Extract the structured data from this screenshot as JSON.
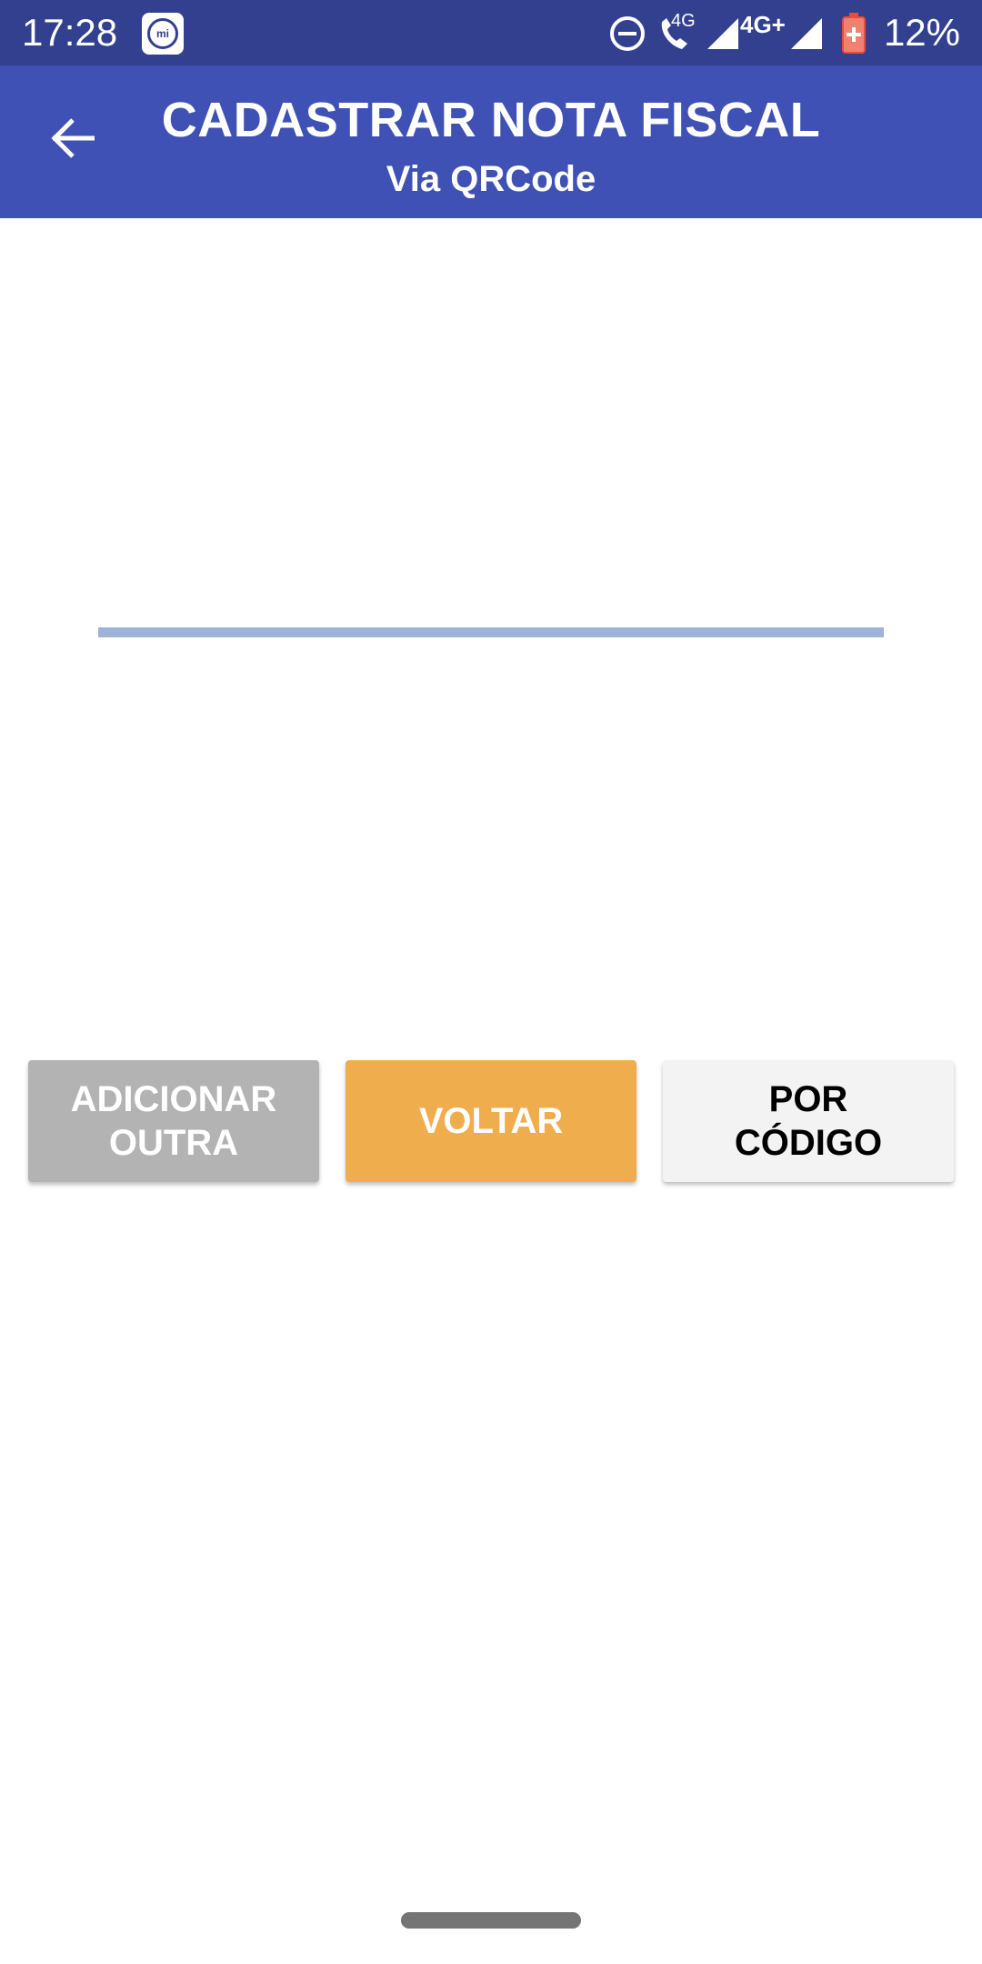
{
  "status_bar": {
    "time": "17:28",
    "network_small_label": "4G",
    "network_label": "4G+",
    "battery": "12%"
  },
  "app_bar": {
    "title": "CADASTRAR NOTA FISCAL",
    "subtitle": "Via QRCode"
  },
  "buttons": {
    "add_another": "ADICIONAR\nOUTRA",
    "back": "VOLTAR",
    "by_code": "POR\nCÓDIGO"
  },
  "colors": {
    "status_bar": "#33408f",
    "app_bar": "#3f51b5",
    "scan_line": "#9fb3d9",
    "add_button": "#b3b3b3",
    "back_button": "#f0ad4e",
    "code_button": "#f3f3f3",
    "battery_low": "#e74c3c"
  },
  "icons": {
    "back": "arrow-left-icon",
    "notification": "mi-app-icon",
    "dnd": "do-not-disturb-icon",
    "call": "wifi-call-icon",
    "signal": "signal-icon",
    "battery": "battery-low-icon"
  }
}
